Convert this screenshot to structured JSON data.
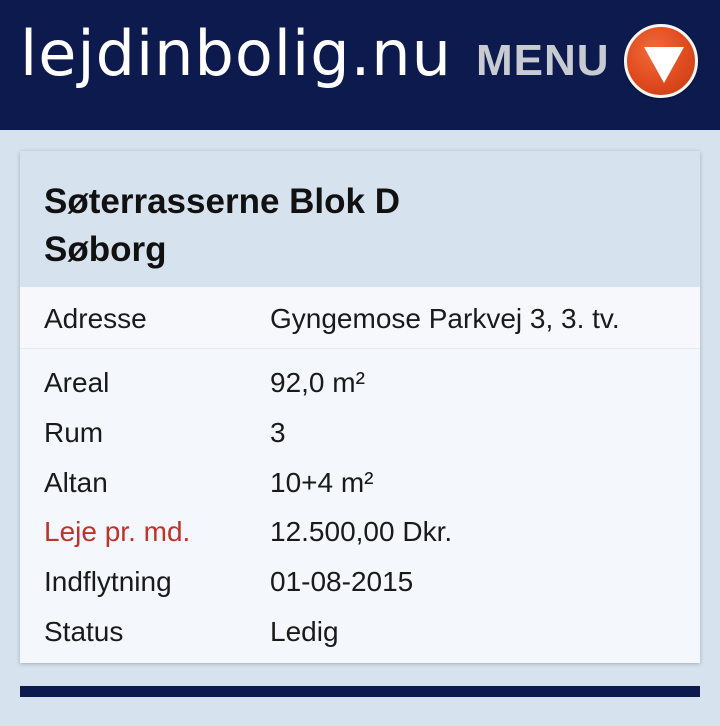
{
  "header": {
    "logo": "lejdinbolig.nu",
    "menu_label": "MENU",
    "menu_icon": "triangle-down-icon"
  },
  "colors": {
    "header_bg": "#0c1a4e",
    "accent": "#df4a1e",
    "highlight_label": "#c0332a"
  },
  "listing": {
    "title_line1": "Søterrasserne Blok D",
    "title_line2": "Søborg",
    "address": {
      "label": "Adresse",
      "value": "Gyngemose Parkvej 3, 3. tv."
    },
    "details": [
      {
        "label": "Areal",
        "value": "92,0 m²"
      },
      {
        "label": "Rum",
        "value": "3"
      },
      {
        "label": "Altan",
        "value": "10+4 m²"
      },
      {
        "label": "Leje pr. md.",
        "value": "12.500,00 Dkr."
      },
      {
        "label": "Indflytning",
        "value": "01-08-2015"
      },
      {
        "label": "Status",
        "value": "Ledig"
      }
    ]
  }
}
